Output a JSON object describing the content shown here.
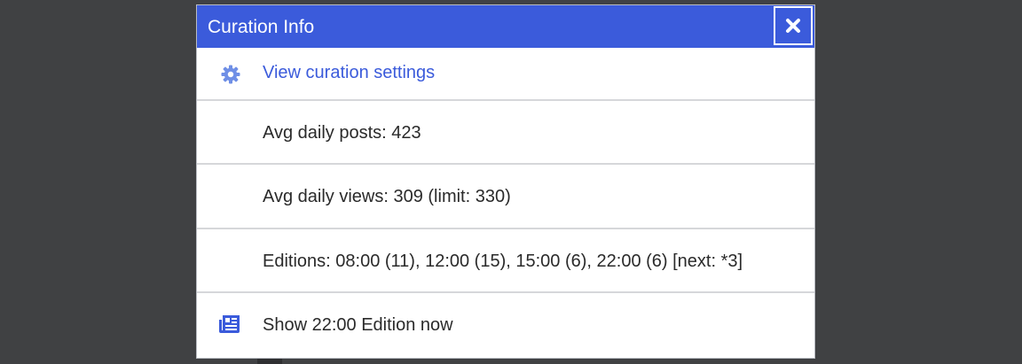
{
  "dialog": {
    "title": "Curation Info",
    "close_icon": "close-x-icon"
  },
  "items": {
    "settings_link": {
      "label": "View curation settings",
      "icon": "gear-icon"
    },
    "avg_posts": "Avg daily posts: 423",
    "avg_views": "Avg daily views: 309 (limit: 330)",
    "editions": "Editions: 08:00 (11), 12:00 (15), 15:00 (6), 22:00 (6) [next: *3]",
    "show_edition": {
      "label": "Show 22:00 Edition now",
      "icon": "newspaper-icon"
    }
  },
  "colors": {
    "header": "#3b5bdb",
    "link": "#3b5bdb",
    "icon": "#3b5bdb",
    "backdrop": "#404143"
  }
}
